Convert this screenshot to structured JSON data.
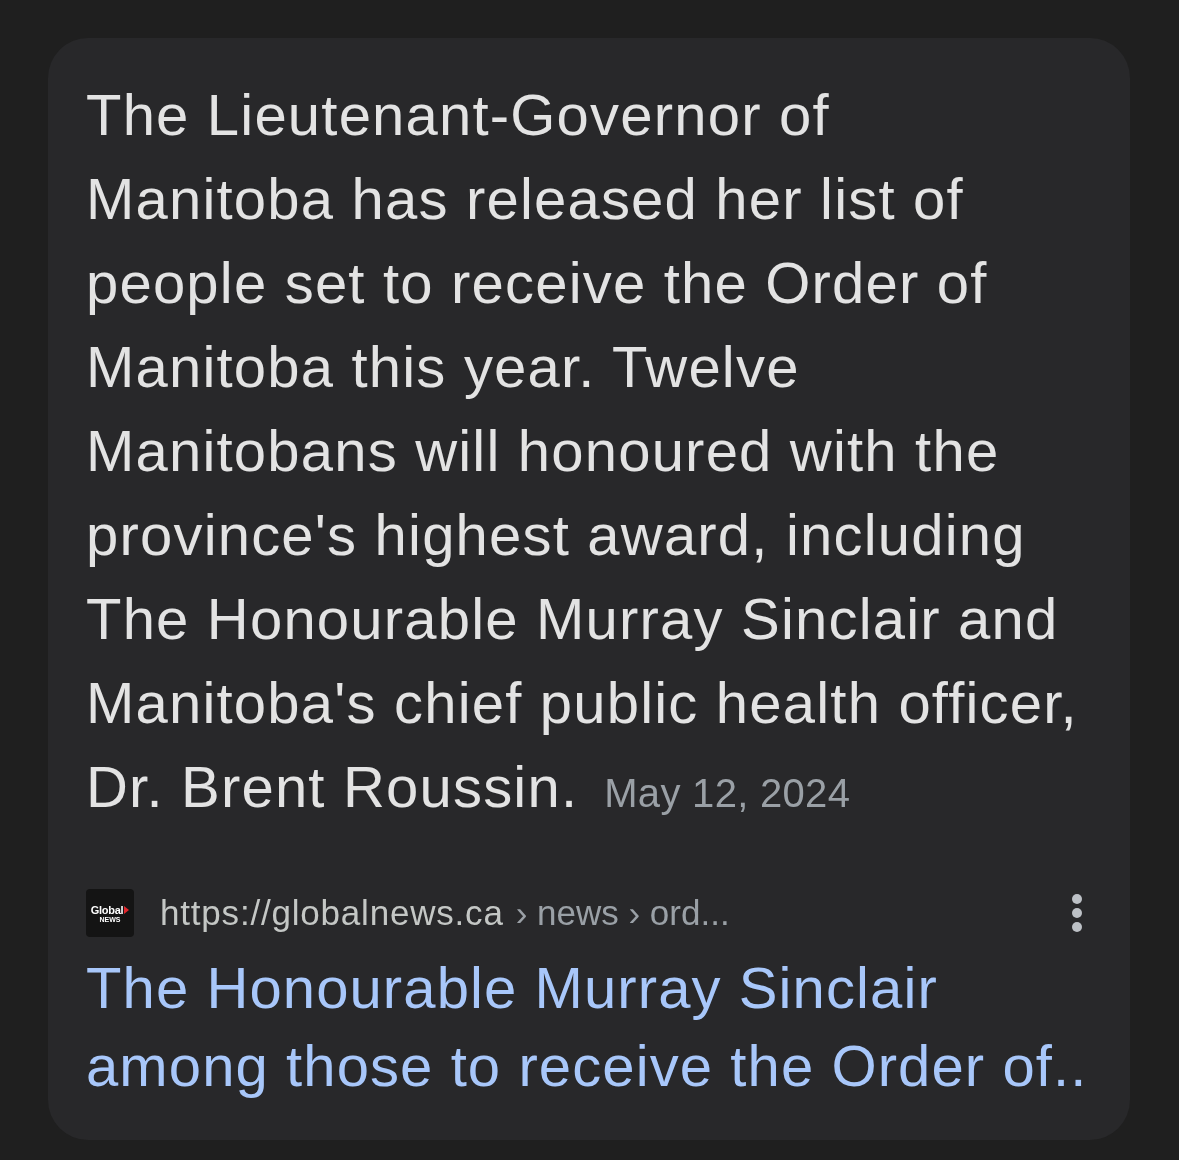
{
  "snippet": {
    "text": "The Lieutenant-Governor of Manitoba has released her list of people set to receive the Order of Manitoba this year. Twelve Manitobans will honoured with the province's highest award, including The Honourable Murray Sinclair and Manitoba's chief public health officer, Dr. Brent Roussin.",
    "date": "May 12, 2024"
  },
  "source": {
    "favicon": {
      "line_1": "Global",
      "line_2": "NEWS"
    },
    "url": "https://globalnews.ca",
    "breadcrumb": "› news › ord..."
  },
  "title": "The Honourable Murray Sinclair among those to receive the Order of.."
}
